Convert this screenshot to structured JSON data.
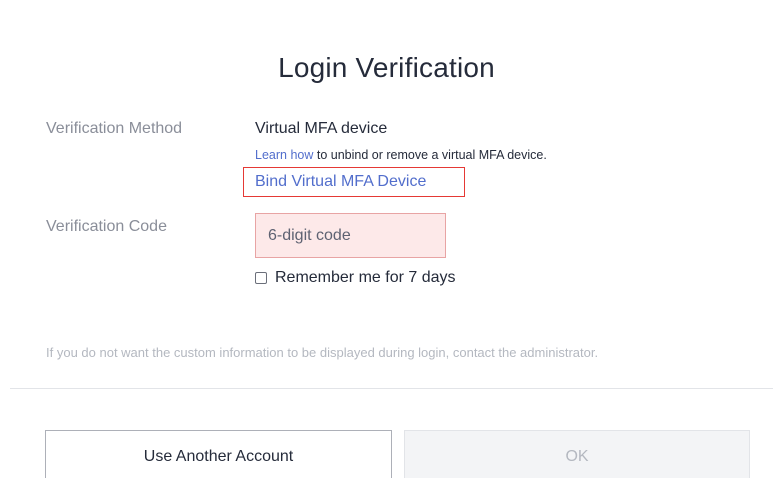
{
  "dialog": {
    "title": "Login Verification",
    "method_label": "Verification Method",
    "method_value": "Virtual MFA device",
    "learn_link": "Learn how",
    "learn_suffix": " to unbind or remove a virtual MFA device.",
    "bind_link": "Bind Virtual MFA Device",
    "code_label": "Verification Code",
    "code_placeholder": "6-digit code",
    "code_value": "",
    "remember_label": "Remember me for 7 days",
    "remember_checked": false,
    "info_text": "If you do not want the custom information to be displayed during login, contact the administrator."
  },
  "buttons": {
    "another_account": "Use Another Account",
    "ok": "OK"
  },
  "colors": {
    "link": "#526ecc",
    "highlight_border": "#e53935",
    "input_error_bg": "#fde9e9",
    "muted_text": "#8a8e99"
  }
}
